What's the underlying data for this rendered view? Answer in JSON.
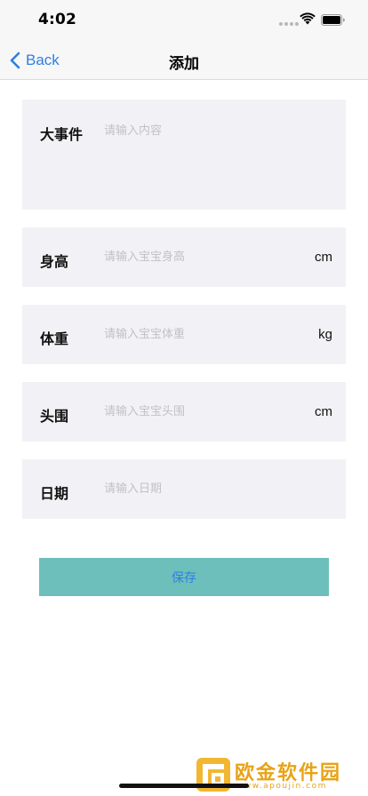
{
  "status_bar": {
    "time": "4:02"
  },
  "nav": {
    "back_label": "Back",
    "title": "添加"
  },
  "form": {
    "event": {
      "label": "大事件",
      "placeholder": "请输入内容"
    },
    "height": {
      "label": "身高",
      "placeholder": "请输入宝宝身高",
      "unit": "cm"
    },
    "weight": {
      "label": "体重",
      "placeholder": "请输入宝宝体重",
      "unit": "kg"
    },
    "head": {
      "label": "头围",
      "placeholder": "请输入宝宝头围",
      "unit": "cm"
    },
    "date": {
      "label": "日期",
      "placeholder": "请输入日期"
    }
  },
  "save_label": "保存",
  "watermark": {
    "brand": "欧金软件园",
    "url": "www.apoujin.com"
  },
  "colors": {
    "accent": "#2f7fe0",
    "card_bg": "#f2f2f6",
    "save_bg": "#6dbfbb",
    "placeholder": "#c2c2c6",
    "watermark": "#e8a317"
  }
}
